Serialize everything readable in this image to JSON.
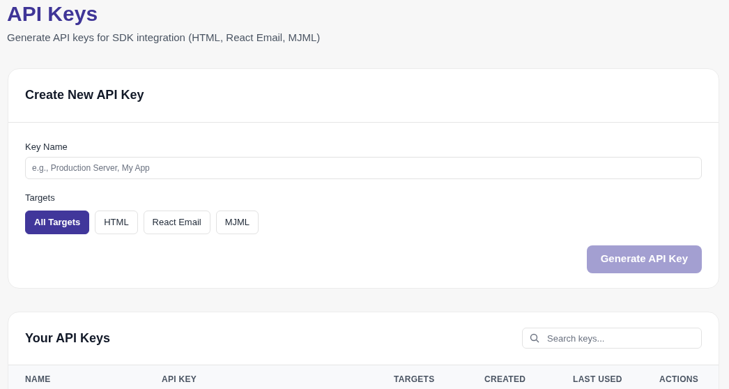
{
  "header": {
    "title": "API Keys",
    "subtitle": "Generate API keys for SDK integration (HTML, React Email, MJML)"
  },
  "create_card": {
    "title": "Create New API Key",
    "key_name": {
      "label": "Key Name",
      "placeholder": "e.g., Production Server, My App"
    },
    "targets_label": "Targets",
    "targets": [
      {
        "label": "All Targets",
        "selected": true
      },
      {
        "label": "HTML",
        "selected": false
      },
      {
        "label": "React Email",
        "selected": false
      },
      {
        "label": "MJML",
        "selected": false
      }
    ],
    "generate_button": {
      "label": "Generate API Key",
      "disabled": true
    }
  },
  "keys_card": {
    "title": "Your API Keys",
    "search": {
      "placeholder": "Search keys..."
    },
    "table": {
      "columns": [
        "NAME",
        "API KEY",
        "TARGETS",
        "CREATED",
        "LAST USED",
        "ACTIONS"
      ]
    }
  }
}
